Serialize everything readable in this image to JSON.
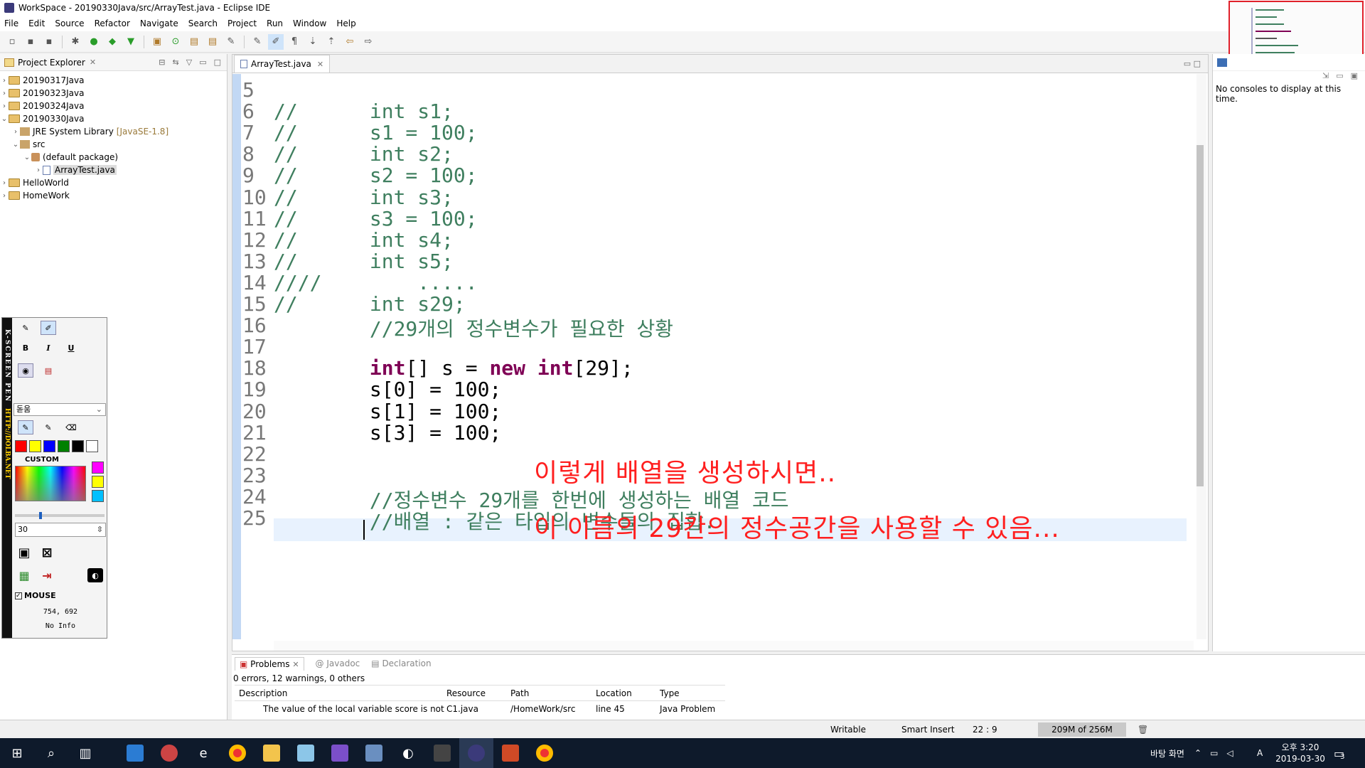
{
  "window": {
    "title": "WorkSpace - 20190330Java/src/ArrayTest.java - Eclipse IDE"
  },
  "menu": [
    "File",
    "Edit",
    "Source",
    "Refactor",
    "Navigate",
    "Search",
    "Project",
    "Run",
    "Window",
    "Help"
  ],
  "explorer": {
    "tab_label": "Project Explorer",
    "items": [
      {
        "label": "20190317Java"
      },
      {
        "label": "20190323Java"
      },
      {
        "label": "20190324Java"
      },
      {
        "label": "20190330Java"
      },
      {
        "label": "JRE System Library",
        "suffix": "[JavaSE-1.8]"
      },
      {
        "label": "src"
      },
      {
        "label": "(default package)"
      },
      {
        "label": "ArrayTest.java"
      },
      {
        "label": "HelloWorld"
      },
      {
        "label": "HomeWork"
      }
    ]
  },
  "pen": {
    "vertical_title": "K-SCREEN PEN",
    "url": "HTTP://DOLBA.NET",
    "bold": "B",
    "italic": "I",
    "underline": "U",
    "font": "돋움",
    "custom_label": "CUSTOM",
    "size_value": "30",
    "mouse_label": "MOUSE",
    "coords": "754, 692",
    "info": "No Info",
    "colors": [
      "#ff0000",
      "#ffff00",
      "#0000ff",
      "#008000",
      "#000000",
      "#ffffff"
    ],
    "extra_colors": [
      "#ff00ff",
      "#ffff00",
      "#00c0ff"
    ]
  },
  "editor": {
    "tab_label": "ArrayTest.java",
    "lines": [
      {
        "n": "5",
        "text": ""
      },
      {
        "n": "6",
        "text": "//      int s1;"
      },
      {
        "n": "7",
        "text": "//      s1 = 100;"
      },
      {
        "n": "8",
        "text": "//      int s2;"
      },
      {
        "n": "9",
        "text": "//      s2 = 100;"
      },
      {
        "n": "10",
        "text": "//      int s3;"
      },
      {
        "n": "11",
        "text": "//      s3 = 100;"
      },
      {
        "n": "12",
        "text": "//      int s4;"
      },
      {
        "n": "13",
        "text": "//      int s5;"
      },
      {
        "n": "14",
        "text": "////        ....."
      },
      {
        "n": "15",
        "text": "//      int s29;"
      },
      {
        "n": "16",
        "text": "        //29개의 정수변수가 필요한 상황"
      },
      {
        "n": "17",
        "text": ""
      },
      {
        "n": "18",
        "text": "        int[] s = new int[29];"
      },
      {
        "n": "19",
        "text": "        s[0] = 100;"
      },
      {
        "n": "20",
        "text": "        s[1] = 100;"
      },
      {
        "n": "21",
        "text": "        s[3] = 100;"
      },
      {
        "n": "22",
        "text": ""
      },
      {
        "n": "23",
        "text": ""
      },
      {
        "n": "24",
        "text": "        //정수변수 29개를 한번에 생성하는 배열 코드"
      },
      {
        "n": "25",
        "text": "        //배열 : 같은 타입의 변수들의 집합."
      }
    ],
    "annotation1": "이렇게 배열을 생성하시면..",
    "annotation2": "이 이름의 29칸의 정수공간을 사용할 수 있음..."
  },
  "console": {
    "message": "No consoles to display at this time."
  },
  "problems": {
    "tabs": [
      "Problems",
      "Javadoc",
      "Declaration"
    ],
    "summary": "0 errors, 12 warnings, 0 others",
    "headers": [
      "Description",
      "Resource",
      "Path",
      "Location",
      "Type"
    ],
    "rows": [
      [
        "The value of the local variable score is not us",
        "C1.java",
        "/HomeWork/src",
        "line 45",
        "Java Problem"
      ]
    ]
  },
  "status": {
    "writable": "Writable",
    "insert": "Smart Insert",
    "position": "22 : 9",
    "heap": "209M of 256M"
  },
  "taskbar": {
    "desktop": "바탕 화면",
    "ime": "A",
    "time": "오후 3:20",
    "date": "2019-03-30",
    "notifications": "3"
  }
}
